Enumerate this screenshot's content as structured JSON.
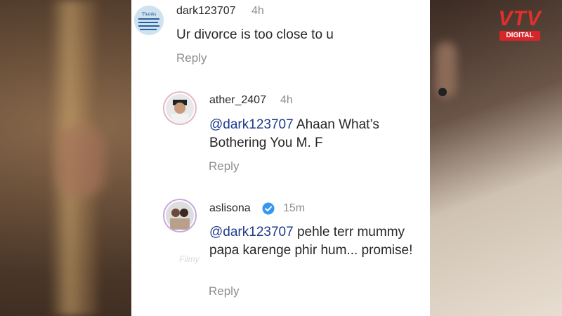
{
  "brand": {
    "logo_text": "VTV",
    "logo_subtext": "DIGITAL",
    "logo_color": "#e0302c"
  },
  "watermark": "Filmy",
  "comments": [
    {
      "username": "dark123707",
      "time": "4h",
      "text": "Ur divorce is too close to u",
      "reply_label": "Reply",
      "avatar_text": "Thanks"
    },
    {
      "username": "ather_2407",
      "time": "4h",
      "mention": "@dark123707",
      "text": "Ahaan What’s Bothering You M. F",
      "reply_label": "Reply"
    },
    {
      "username": "aslisona",
      "verified": true,
      "time": "15m",
      "mention": "@dark123707",
      "text": "pehle terr mummy papa karenge phir hum... promise!",
      "reply_label": "Reply"
    }
  ],
  "colors": {
    "mention": "#1e3a8a",
    "verified": "#3797f0",
    "muted": "#8e8e8e"
  }
}
